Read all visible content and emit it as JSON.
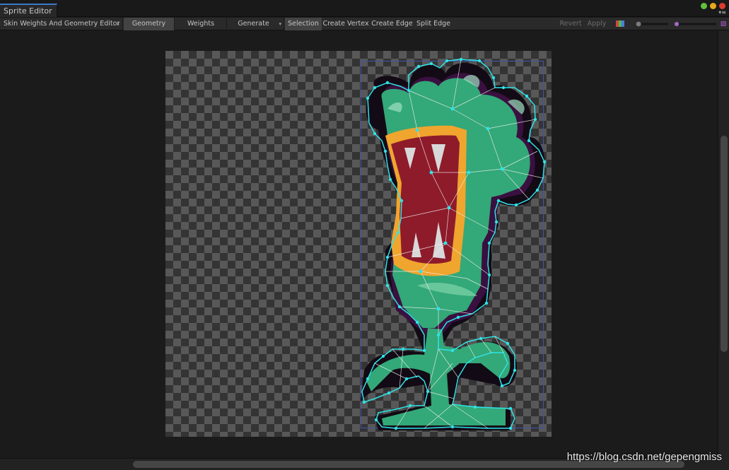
{
  "window": {
    "tab_title": "Sprite Editor",
    "buttons": [
      {
        "name": "minimize",
        "color": "#5fc13b"
      },
      {
        "name": "maximize",
        "color": "#e8a81e"
      },
      {
        "name": "close",
        "color": "#dd3b2d"
      }
    ]
  },
  "toolbar": {
    "module_select": "Skin Weights And Geometry Editor",
    "geometry": "Geometry",
    "weights": "Weights",
    "generate": "Generate",
    "selection": "Selection",
    "create_vertex": "Create Vertex",
    "create_edge": "Create Edge",
    "split_edge": "Split Edge",
    "revert": "Revert",
    "apply": "Apply"
  },
  "viewport": {
    "checker_dark": "#343434",
    "checker_light": "#585858",
    "mesh_color": "#2fe3e8"
  },
  "watermark": "https://blog.csdn.net/gepengmiss"
}
